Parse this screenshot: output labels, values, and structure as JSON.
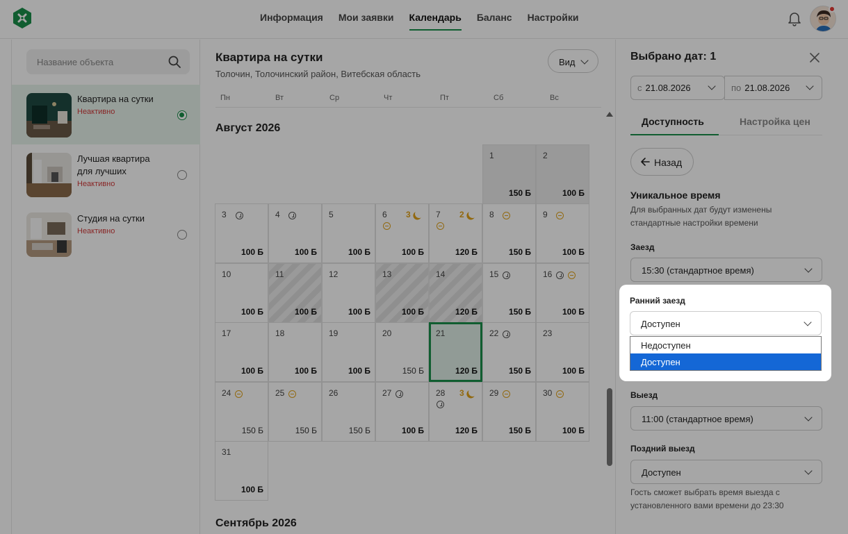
{
  "header": {
    "nav": [
      "Информация",
      "Мои заявки",
      "Календарь",
      "Баланс",
      "Настройки"
    ],
    "active_nav": "Календарь"
  },
  "sidebar": {
    "search_placeholder": "Название объекта",
    "properties": [
      {
        "name": "Квартира на сутки",
        "status": "Неактивно",
        "selected": true
      },
      {
        "name": "Лучшая квартира для лучших",
        "status": "Неактивно",
        "selected": false
      },
      {
        "name": "Студия на сутки",
        "status": "Неактивно",
        "selected": false
      }
    ]
  },
  "calendar": {
    "title": "Квартира на сутки",
    "address": "Толочин, Толочинский район, Витебская область",
    "view_label": "Вид",
    "weekdays": [
      "Пн",
      "Вт",
      "Ср",
      "Чт",
      "Пт",
      "Сб",
      "Вс"
    ],
    "month": "Август 2026",
    "next_month": "Сентябрь 2026",
    "days": [
      {
        "d": "1",
        "price": "150 Б"
      },
      {
        "d": "2",
        "price": "100 Б"
      },
      {
        "d": "3",
        "price": "100 Б"
      },
      {
        "d": "4",
        "price": "100 Б"
      },
      {
        "d": "5",
        "price": "100 Б"
      },
      {
        "d": "6",
        "price": "100 Б",
        "nights": "3"
      },
      {
        "d": "7",
        "price": "120 Б",
        "nights": "2"
      },
      {
        "d": "8",
        "price": "150 Б"
      },
      {
        "d": "9",
        "price": "100 Б"
      },
      {
        "d": "10",
        "price": "100 Б"
      },
      {
        "d": "11",
        "price": "100 Б"
      },
      {
        "d": "12",
        "price": "100 Б"
      },
      {
        "d": "13",
        "price": "100 Б"
      },
      {
        "d": "14",
        "price": "120 Б"
      },
      {
        "d": "15",
        "price": "150 Б"
      },
      {
        "d": "16",
        "price": "100 Б"
      },
      {
        "d": "17",
        "price": "100 Б"
      },
      {
        "d": "18",
        "price": "100 Б"
      },
      {
        "d": "19",
        "price": "100 Б"
      },
      {
        "d": "20",
        "price": "150 Б"
      },
      {
        "d": "21",
        "price": "120 Б"
      },
      {
        "d": "22",
        "price": "150 Б"
      },
      {
        "d": "23",
        "price": "100 Б"
      },
      {
        "d": "24",
        "price": "150 Б"
      },
      {
        "d": "25",
        "price": "150 Б"
      },
      {
        "d": "26",
        "price": "150 Б"
      },
      {
        "d": "27",
        "price": "100 Б"
      },
      {
        "d": "28",
        "price": "120 Б",
        "nights": "3"
      },
      {
        "d": "29",
        "price": "150 Б"
      },
      {
        "d": "30",
        "price": "100 Б"
      },
      {
        "d": "31",
        "price": "100 Б"
      }
    ]
  },
  "panel": {
    "title": "Выбрано дат: 1",
    "from_prefix": "с",
    "from_date": "21.08.2026",
    "to_prefix": "по",
    "to_date": "21.08.2026",
    "tabs": [
      "Доступность",
      "Настройка цен"
    ],
    "back_label": "Назад",
    "unique_time_title": "Уникальное время",
    "unique_time_desc": "Для выбранных дат будут изменены стандартные настройки времени",
    "checkin_label": "Заезд",
    "checkin_value": "15:30 (стандартное время)",
    "early_checkin_label": "Ранний заезд",
    "early_checkin_value": "Доступен",
    "early_checkin_options": [
      "Недоступен",
      "Доступен"
    ],
    "checkout_label": "Выезд",
    "checkout_value": "11:00 (стандартное время)",
    "late_checkout_label": "Поздний выезд",
    "late_checkout_value": "Доступен",
    "late_checkout_hint": "Гость сможет выбрать время выезда с установленного вами времени до 23:30"
  },
  "colors": {
    "accent": "#1a8f4a",
    "warning": "#e0a21a",
    "inactive": "#d23b3b",
    "option_highlight": "#1467d6"
  }
}
